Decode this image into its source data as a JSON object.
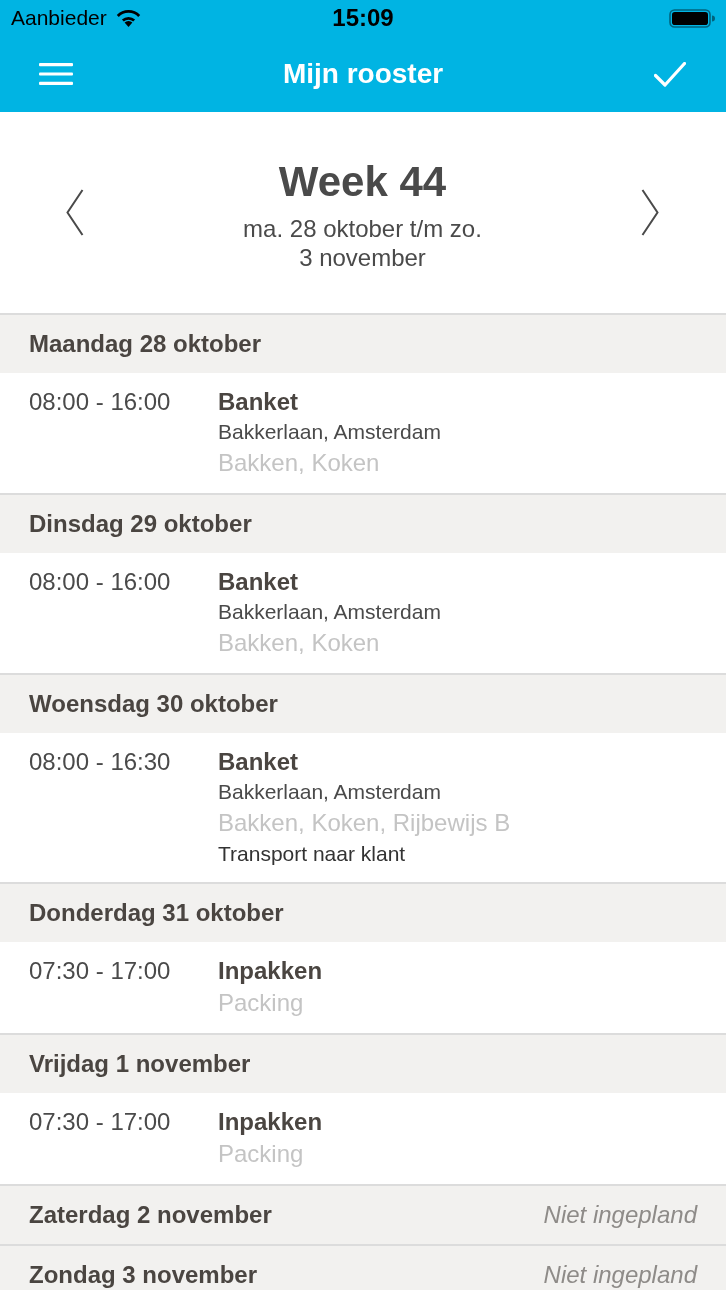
{
  "status_bar": {
    "carrier": "Aanbieder",
    "time": "15:09"
  },
  "nav_bar": {
    "title": "Mijn rooster"
  },
  "week": {
    "title": "Week 44",
    "range": "ma. 28 oktober t/m zo. 3 november"
  },
  "days": [
    {
      "label": "Maandag 28 oktober",
      "shifts": [
        {
          "time": "08:00 - 16:00",
          "title": "Banket",
          "lines": [
            {
              "kind": "location",
              "text": "Bakkerlaan, Amsterdam"
            },
            {
              "kind": "skills",
              "text": "Bakken, Koken"
            }
          ]
        }
      ]
    },
    {
      "label": "Dinsdag 29 oktober",
      "shifts": [
        {
          "time": "08:00 - 16:00",
          "title": "Banket",
          "lines": [
            {
              "kind": "location",
              "text": "Bakkerlaan, Amsterdam"
            },
            {
              "kind": "skills",
              "text": "Bakken, Koken"
            }
          ]
        }
      ]
    },
    {
      "label": "Woensdag 30 oktober",
      "shifts": [
        {
          "time": "08:00 - 16:30",
          "title": "Banket",
          "lines": [
            {
              "kind": "location",
              "text": "Bakkerlaan, Amsterdam"
            },
            {
              "kind": "skills",
              "text": "Bakken, Koken, Rijbewijs B"
            },
            {
              "kind": "note",
              "text": "Transport naar klant"
            }
          ]
        }
      ]
    },
    {
      "label": "Donderdag 31 oktober",
      "shifts": [
        {
          "time": "07:30 - 17:00",
          "title": "Inpakken",
          "lines": [
            {
              "kind": "skills",
              "text": "Packing"
            }
          ]
        }
      ]
    },
    {
      "label": "Vrijdag 1 november",
      "shifts": [
        {
          "time": "07:30 - 17:00",
          "title": "Inpakken",
          "lines": [
            {
              "kind": "skills",
              "text": "Packing"
            }
          ]
        }
      ]
    },
    {
      "label": "Zaterdag 2 november",
      "status": "Niet ingepland"
    },
    {
      "label": "Zondag 3 november",
      "status": "Niet ingepland"
    }
  ]
}
